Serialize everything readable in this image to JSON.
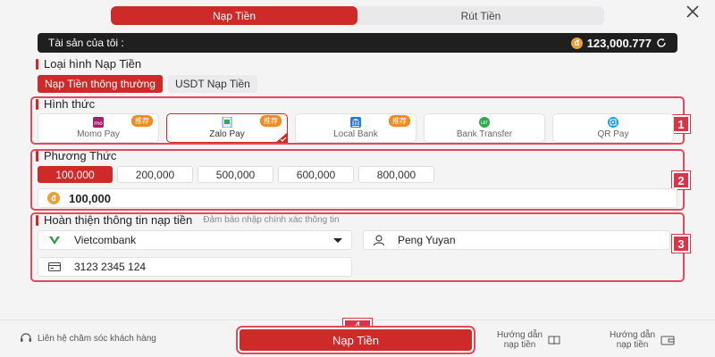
{
  "tabs": {
    "deposit": "Nạp Tiền",
    "withdraw": "Rút Tiền"
  },
  "assets": {
    "label": "Tài sản của tôi :",
    "coin_symbol": "đ",
    "balance": "123,000.777"
  },
  "deposit_type": {
    "title": "Loại hình Nạp Tiền",
    "options": [
      "Nạp Tiền thông thường",
      "USDT Nạp Tiền"
    ]
  },
  "method_section": {
    "title": "Hình thức",
    "badge": "1",
    "methods": [
      {
        "name": "Momo Pay",
        "tag": "推荐",
        "icon": "momo-icon"
      },
      {
        "name": "Zalo Pay",
        "tag": "推荐",
        "icon": "zalo-icon"
      },
      {
        "name": "Local Bank",
        "tag": "推荐",
        "icon": "bank-icon"
      },
      {
        "name": "Bank Transfer",
        "tag": "",
        "icon": "transfer-icon"
      },
      {
        "name": "QR Pay",
        "tag": "",
        "icon": "qr-icon"
      }
    ]
  },
  "amount_section": {
    "title": "Phương Thức",
    "badge": "2",
    "amounts": [
      "100,000",
      "200,000",
      "500,000",
      "600,000",
      "800,000"
    ],
    "coin_symbol": "đ",
    "input_value": "100,000"
  },
  "info_section": {
    "title": "Hoàn thiện thông tin nạp tiền",
    "hint": "Đảm bảo nhập chính xác thông tin",
    "badge": "3",
    "bank": "Vietcombank",
    "name": "Peng Yuyan",
    "account": "3123 2345 124"
  },
  "footer": {
    "support": "Liên hệ chăm sóc khách hàng",
    "submit": "Nạp Tiền",
    "submit_badge": "4",
    "guide1_line1": "Hướng dẫn",
    "guide1_line2": "nạp tiền",
    "guide2_line1": "Hướng dẫn",
    "guide2_line2": "nạp tiền"
  },
  "colors": {
    "accent": "#cf2a2a",
    "highlight": "#e24a5a",
    "coin": "#e8a23a",
    "tag": "#f08a24"
  }
}
